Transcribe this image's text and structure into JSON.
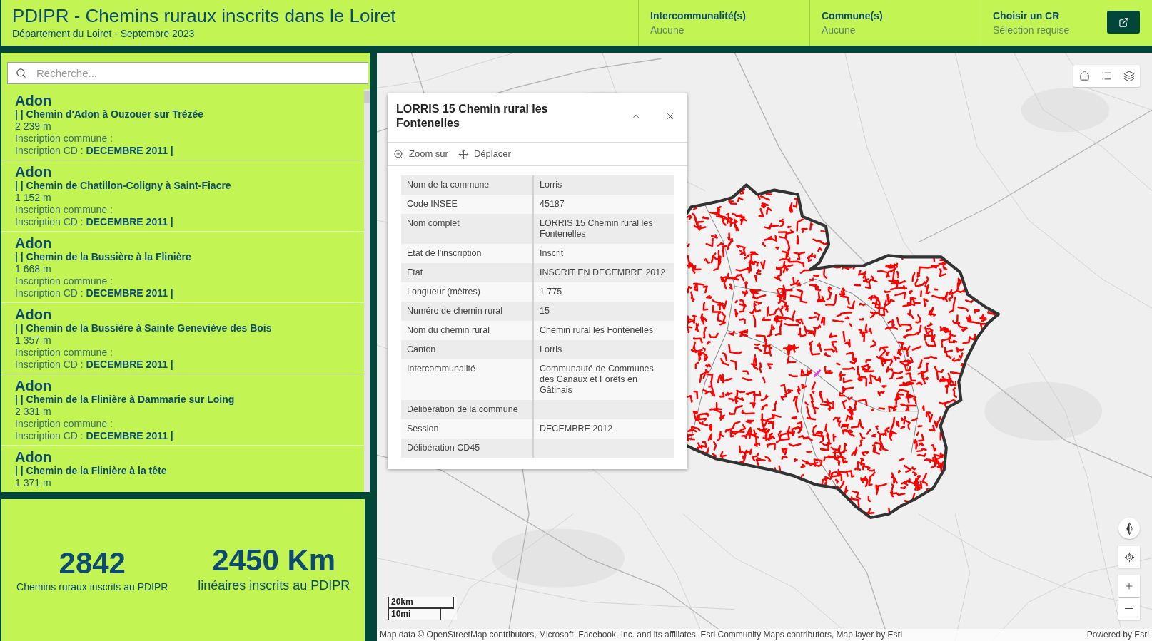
{
  "header": {
    "title": "PDIPR - Chemins ruraux inscrits dans le Loiret",
    "subtitle": "Département du Loiret - Septembre 2023",
    "filters": [
      {
        "kind": "plain",
        "label": "Intercommunalité(s)",
        "value": "Aucune"
      },
      {
        "kind": "plain",
        "label": "Commune(s)",
        "value": "Aucune"
      },
      {
        "kind": "action",
        "label": "Choisir un CR",
        "value": "Sélection requise"
      }
    ]
  },
  "sidebar": {
    "search": {
      "placeholder": "Recherche..."
    },
    "items": [
      {
        "commune": "Adon",
        "name": "| | Chemin d'Adon à Ouzouer sur Trézée",
        "length": "2 239 m",
        "inscription_commune": "Inscription commune :",
        "inscription_cd": "Inscription CD : **DECEMBRE 2011 |**"
      },
      {
        "commune": "Adon",
        "name": "| | Chemin de Chatillon-Coligny à Saint-Fiacre",
        "length": "1 152 m",
        "inscription_commune": "Inscription commune :",
        "inscription_cd": "Inscription CD : **DECEMBRE 2011 |**"
      },
      {
        "commune": "Adon",
        "name": "| | Chemin de la Bussière à la Flinière",
        "length": "1 668 m",
        "inscription_commune": "Inscription commune :",
        "inscription_cd": "Inscription CD : **DECEMBRE 2011 |**"
      },
      {
        "commune": "Adon",
        "name": "| | Chemin de la Bussière à Sainte Geneviève des Bois",
        "length": "1 357 m",
        "inscription_commune": "Inscription commune :",
        "inscription_cd": "Inscription CD : **DECEMBRE 2011 |**"
      },
      {
        "commune": "Adon",
        "name": "| | Chemin de la Flinière à Dammarie sur Loing",
        "length": "2 331 m",
        "inscription_commune": "Inscription commune :",
        "inscription_cd": "Inscription CD : **DECEMBRE 2011 |**"
      },
      {
        "commune": "Adon",
        "name": "| | Chemin de la Flinière à la tête",
        "length": "1 371 m"
      }
    ]
  },
  "stats": [
    {
      "value": "2842",
      "label": "Chemins ruraux inscrits au PDIPR"
    },
    {
      "value": "2450 Km",
      "label": "linéaires inscrits au PDIPR"
    }
  ],
  "popup": {
    "title": "LORRIS 15 Chemin rural les Fontenelles",
    "actions": [
      {
        "kind": "zoom",
        "label": "Zoom sur"
      },
      {
        "kind": "move",
        "label": "Déplacer"
      }
    ],
    "fields": [
      {
        "label": "Nom de la commune",
        "value": "Lorris"
      },
      {
        "label": "Code INSEE",
        "value": "45187"
      },
      {
        "label": "Nom complet",
        "value": "LORRIS 15 Chemin rural les Fontenelles"
      },
      {
        "label": "Etat de l'inscription",
        "value": "Inscrit"
      },
      {
        "label": "Etat",
        "value": "INSCRIT EN DECEMBRE 2012"
      },
      {
        "label": "Longueur (mètres)",
        "value": "1 775"
      },
      {
        "label": "Numéro de chemin rural",
        "value": "15"
      },
      {
        "label": "Nom du chemin rural",
        "value": "Chemin rural les Fontenelles"
      },
      {
        "label": "Canton",
        "value": "Lorris"
      },
      {
        "label": "Intercommunalité",
        "value": "Communauté de Communes des Canaux et Forêts en Gâtinais"
      },
      {
        "label": "Délibération de la commune"
      },
      {
        "label": "Session",
        "value": "DECEMBRE 2012"
      },
      {
        "label": "Délibération CD45"
      }
    ]
  },
  "map": {
    "scale_bar": {
      "metric": "20km",
      "imperial": "10mi"
    },
    "attribution": "Map data © OpenStreetMap contributors, Microsoft, Facebook, Inc. and its affiliates, Esri Community Maps contributors, Map layer by Esri",
    "powered_by": "Powered by Esri"
  }
}
